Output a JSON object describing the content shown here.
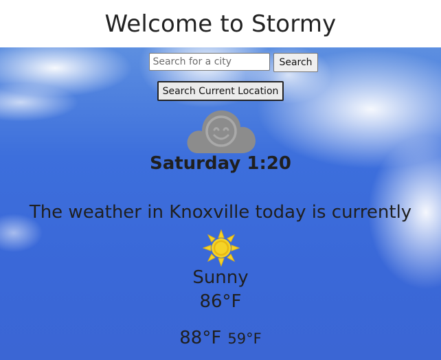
{
  "header": {
    "title": "Welcome to Stormy"
  },
  "search": {
    "placeholder": "Search for a city",
    "value": "",
    "button_label": "Search",
    "location_button_label": "Search Current Location"
  },
  "icons": {
    "status": "smiling-cloud-icon",
    "condition": "sun-icon"
  },
  "weather": {
    "day_time": "Saturday 1:20",
    "headline": "The weather in Knoxville today is currently",
    "condition": "Sunny",
    "temperature": "86°F",
    "high": "88°F",
    "low": "59°F"
  },
  "colors": {
    "sky": "#3d6fdc",
    "cloud_icon": "#8c8c8c",
    "sun": "#f5d327"
  }
}
